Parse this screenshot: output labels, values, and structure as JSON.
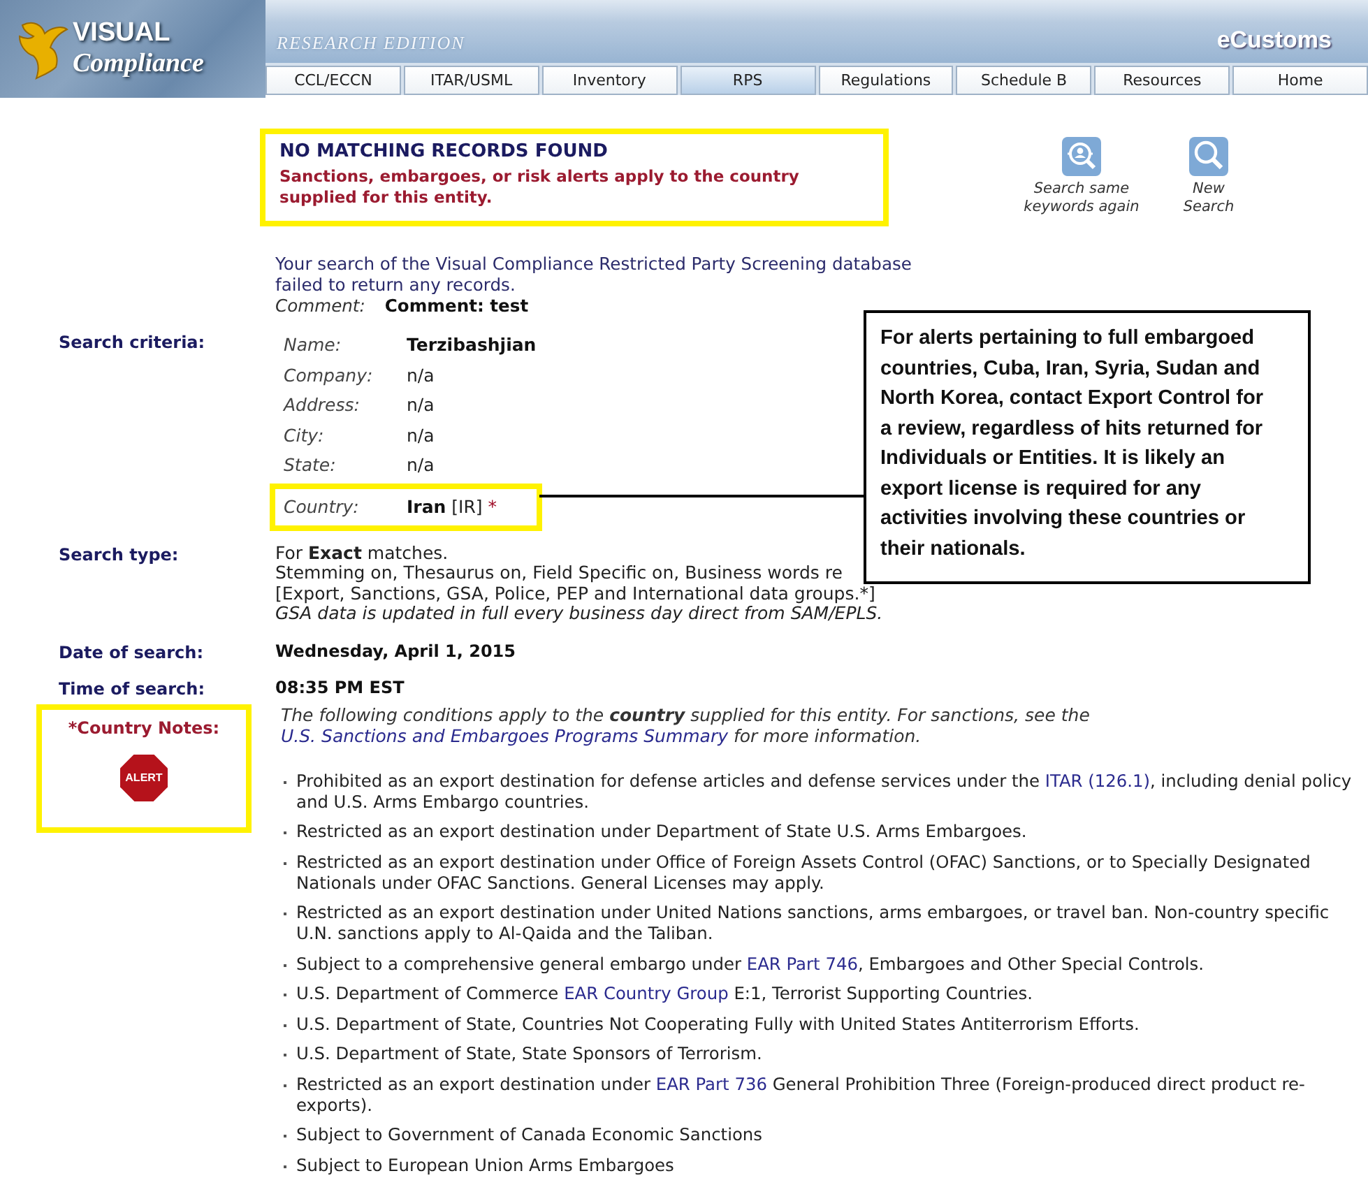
{
  "header": {
    "logo_top": "VISUAL",
    "logo_bottom": "Compliance",
    "edition": "RESEARCH EDITION",
    "product": "eCustoms"
  },
  "tabs": [
    {
      "label": "CCL/ECCN",
      "selected": false
    },
    {
      "label": "ITAR/USML",
      "selected": false
    },
    {
      "label": "Inventory",
      "selected": false
    },
    {
      "label": "RPS",
      "selected": true
    },
    {
      "label": "Regulations",
      "selected": false
    },
    {
      "label": "Schedule B",
      "selected": false
    },
    {
      "label": "Resources",
      "selected": false
    },
    {
      "label": "Home",
      "selected": false
    }
  ],
  "result_box": {
    "title": "NO MATCHING RECORDS FOUND",
    "alert": "Sanctions, embargoes, or risk alerts apply to the country supplied for this entity."
  },
  "actions": [
    {
      "kind": "repeat",
      "label": "Search same keywords again"
    },
    {
      "kind": "new",
      "label": "New Search"
    }
  ],
  "summary": "Your search of the Visual Compliance Restricted Party Screening database failed to return any records.",
  "comment": {
    "label": "Comment:",
    "value": "Comment: test"
  },
  "criteria": {
    "label": "Search criteria:",
    "fields": [
      {
        "kind": "bold",
        "label": "Name:",
        "value": "Terzibashjian"
      },
      {
        "kind": "plain",
        "label": "Company:",
        "value": "n/a"
      },
      {
        "kind": "plain",
        "label": "Address:",
        "value": "n/a"
      },
      {
        "kind": "plain",
        "label": "City:",
        "value": "n/a"
      },
      {
        "kind": "plain",
        "label": "State:",
        "value": "n/a"
      },
      {
        "kind": "country",
        "label": "Country:",
        "value": "Iran",
        "code": "[IR]",
        "marker": "*"
      }
    ]
  },
  "search_type": {
    "label": "Search type:",
    "lines": [
      {
        "kind": "rich",
        "text": "For **Exact** matches."
      },
      {
        "kind": "plain",
        "text": "Stemming on, Thesaurus on, Field Specific on, Business words re"
      },
      {
        "kind": "plain",
        "text": "[Export, Sanctions, GSA, Police, PEP and International data groups.*]"
      },
      {
        "kind": "italic",
        "text": "GSA data is updated in full every business day direct from SAM/EPLS."
      }
    ]
  },
  "date": {
    "label": "Date of search:",
    "value": "Wednesday, April 1, 2015"
  },
  "time": {
    "label": "Time of search:",
    "value": "08:35 PM EST"
  },
  "country_notes": {
    "marker": "*",
    "label": "Country Notes:",
    "badge": "ALERT",
    "intro": [
      {
        "text": "The following conditions apply to the **country** supplied for this entity. For sanctions, see the ",
        "link": false
      },
      {
        "text": "U.S. Sanctions and Embargoes Programs Summary",
        "link": true
      },
      {
        "text": " for more information.",
        "link": false
      }
    ],
    "items": [
      [
        {
          "text": "Prohibited as an export destination for defense articles and defense services under the ",
          "link": false
        },
        {
          "text": "ITAR (126.1)",
          "link": true
        },
        {
          "text": ", including denial policy and U.S. Arms Embargo countries.",
          "link": false
        }
      ],
      [
        {
          "text": "Restricted as an export destination under Department of State U.S. Arms Embargoes.",
          "link": false
        }
      ],
      [
        {
          "text": "Restricted as an export destination under Office of Foreign Assets Control (OFAC) Sanctions, or to Specially Designated Nationals under OFAC Sanctions. General Licenses may apply.",
          "link": false
        }
      ],
      [
        {
          "text": "Restricted as an export destination under United Nations sanctions, arms embargoes, or travel ban. Non-country specific U.N. sanctions apply to Al-Qaida and the Taliban.",
          "link": false
        }
      ],
      [
        {
          "text": "Subject to a comprehensive general embargo under ",
          "link": false
        },
        {
          "text": "EAR Part 746",
          "link": true
        },
        {
          "text": ", Embargoes and Other Special Controls.",
          "link": false
        }
      ],
      [
        {
          "text": "U.S. Department of Commerce ",
          "link": false
        },
        {
          "text": "EAR Country Group",
          "link": true
        },
        {
          "text": " E:1, Terrorist Supporting Countries.",
          "link": false
        }
      ],
      [
        {
          "text": "U.S. Department of State, Countries Not Cooperating Fully with United States Antiterrorism Efforts.",
          "link": false
        }
      ],
      [
        {
          "text": "U.S. Department of State, State Sponsors of Terrorism.",
          "link": false
        }
      ],
      [
        {
          "text": "Restricted as an export destination under ",
          "link": false
        },
        {
          "text": "EAR Part 736",
          "link": true
        },
        {
          "text": " General Prohibition Three (Foreign-produced direct product re-exports).",
          "link": false
        }
      ],
      [
        {
          "text": "Subject to Government of Canada Economic Sanctions",
          "link": false
        }
      ],
      [
        {
          "text": "Subject to European Union Arms Embargoes",
          "link": false
        }
      ]
    ]
  },
  "callout": "For alerts pertaining to full embargoed countries, Cuba, Iran, Syria, Sudan and North Korea, contact Export Control for a review, regardless of hits returned for Individuals or Entities. It is likely an export license is required for any activities involving these countries or their nationals."
}
